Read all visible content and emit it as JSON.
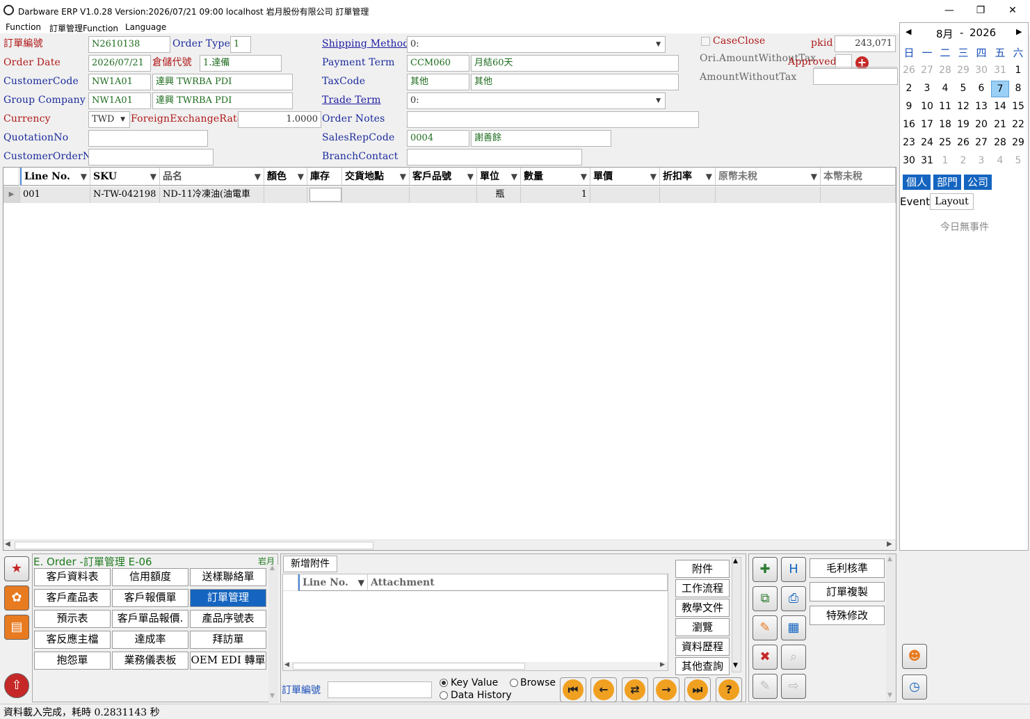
{
  "window": {
    "title": "Darbware ERP V1.0.28 Version:2026/07/21 09:00   localhost 岩月股份有限公司 訂單管理",
    "min": "—",
    "max": "❐",
    "close": "✕"
  },
  "menu": [
    "Function",
    "訂單管理Function",
    "Language"
  ],
  "form": {
    "order_no_label": "訂單編號",
    "order_no": "N2610138",
    "order_type_label": "Order Type",
    "order_type": "1",
    "order_date_label": "Order Date",
    "order_date": "2026/07/21",
    "warehouse_label": "倉儲代號",
    "warehouse": "1.達備",
    "customer_code_label": "CustomerCode",
    "customer_code": "NW1A01",
    "customer_name": "達興 TWRBA PDI",
    "group_company_label": "Group Company",
    "group_code": "NW1A01",
    "group_name": "達興 TWRBA PDI",
    "currency_label": "Currency",
    "currency": "TWD",
    "fx_label": "ForeignExchangeRate",
    "fx": "1.0000",
    "quotation_label": "QuotationNo",
    "quotation": "",
    "customer_order_label": "CustomerOrderNo",
    "customer_order": "",
    "shipping_label": "Shipping Method",
    "shipping": "0:",
    "payment_label": "Payment Term",
    "payment_code": "CCM060",
    "payment_name": "月結60天",
    "tax_label": "TaxCode",
    "tax_code": "其他",
    "tax_name": "其他",
    "trade_label": "Trade Term",
    "trade": "0:",
    "notes_label": "Order Notes",
    "notes": "",
    "salesrep_label": "SalesRepCode",
    "salesrep_code": "0004",
    "salesrep_name": "謝善餘",
    "branch_label": "BranchContact",
    "branch": "",
    "caseclose_label": "CaseClose",
    "pkid_label": "pkid",
    "pkid": "243,071",
    "ori_amount_label": "Ori.AmountWithoutTax",
    "approved_label": "Approved",
    "amount_label": "AmountWithoutTax",
    "amount": ""
  },
  "grid": {
    "headers": [
      "Line No.",
      "SKU",
      "品名",
      "顏色",
      "庫存",
      "交貨地點",
      "客戶品號",
      "單位",
      "數量",
      "單價",
      "折扣率",
      "原幣未稅",
      "本幣未稅"
    ],
    "rows": [
      {
        "line": "001",
        "sku": "N-TW-042198",
        "name": "ND-11冷凍油(油電車",
        "color": "",
        "stock": "",
        "place": "",
        "cust_sku": "",
        "unit": "瓶",
        "qty": "1",
        "price": "",
        "discount": "",
        "ori": "",
        "local": ""
      }
    ]
  },
  "calendar": {
    "prev": "◀",
    "next": "▶",
    "month": "8月",
    "sep": "-",
    "year": "2026",
    "weekdays": [
      "日",
      "一",
      "二",
      "三",
      "四",
      "五",
      "六"
    ],
    "weeks": [
      [
        "26",
        "27",
        "28",
        "29",
        "30",
        "31",
        "1"
      ],
      [
        "2",
        "3",
        "4",
        "5",
        "6",
        "7",
        "8"
      ],
      [
        "9",
        "10",
        "11",
        "12",
        "13",
        "14",
        "15"
      ],
      [
        "16",
        "17",
        "18",
        "19",
        "20",
        "21",
        "22"
      ],
      [
        "23",
        "24",
        "25",
        "26",
        "27",
        "28",
        "29"
      ],
      [
        "30",
        "31",
        "1",
        "2",
        "3",
        "4",
        "5"
      ]
    ],
    "today": "7",
    "tabs": [
      "個人",
      "部門",
      "公司"
    ],
    "event_label": "Event",
    "layout_label": "Layout",
    "no_event": "今日無事件"
  },
  "module": {
    "title": "E. Order -訂單管理  E-06",
    "user": "岩月",
    "buttons": [
      "客戶資料表",
      "信用額度",
      "送樣聯絡單",
      "客戶產品表",
      "客戶報價單",
      "訂單管理",
      "預示表",
      "客戶單品報價.",
      "產品序號表",
      "客反應主檔",
      "達成率",
      "拜訪單",
      "抱怨單",
      "業務儀表板",
      "OEM EDI 轉單"
    ],
    "selected": "訂單管理"
  },
  "attach": {
    "tab": "新增附件",
    "headers": [
      "Line No.",
      "Attachment"
    ],
    "key_label": "訂單編號",
    "key_value": "",
    "radio": [
      "Key Value",
      "Browse",
      "Data History"
    ],
    "side": [
      "附件",
      "工作流程",
      "教學文件",
      "瀏覽",
      "資料歷程",
      "其他查詢"
    ]
  },
  "actions": [
    "毛利核準",
    "訂單複製",
    "特殊修改"
  ],
  "status": "資料載入完成，耗時 0.2831143 秒"
}
